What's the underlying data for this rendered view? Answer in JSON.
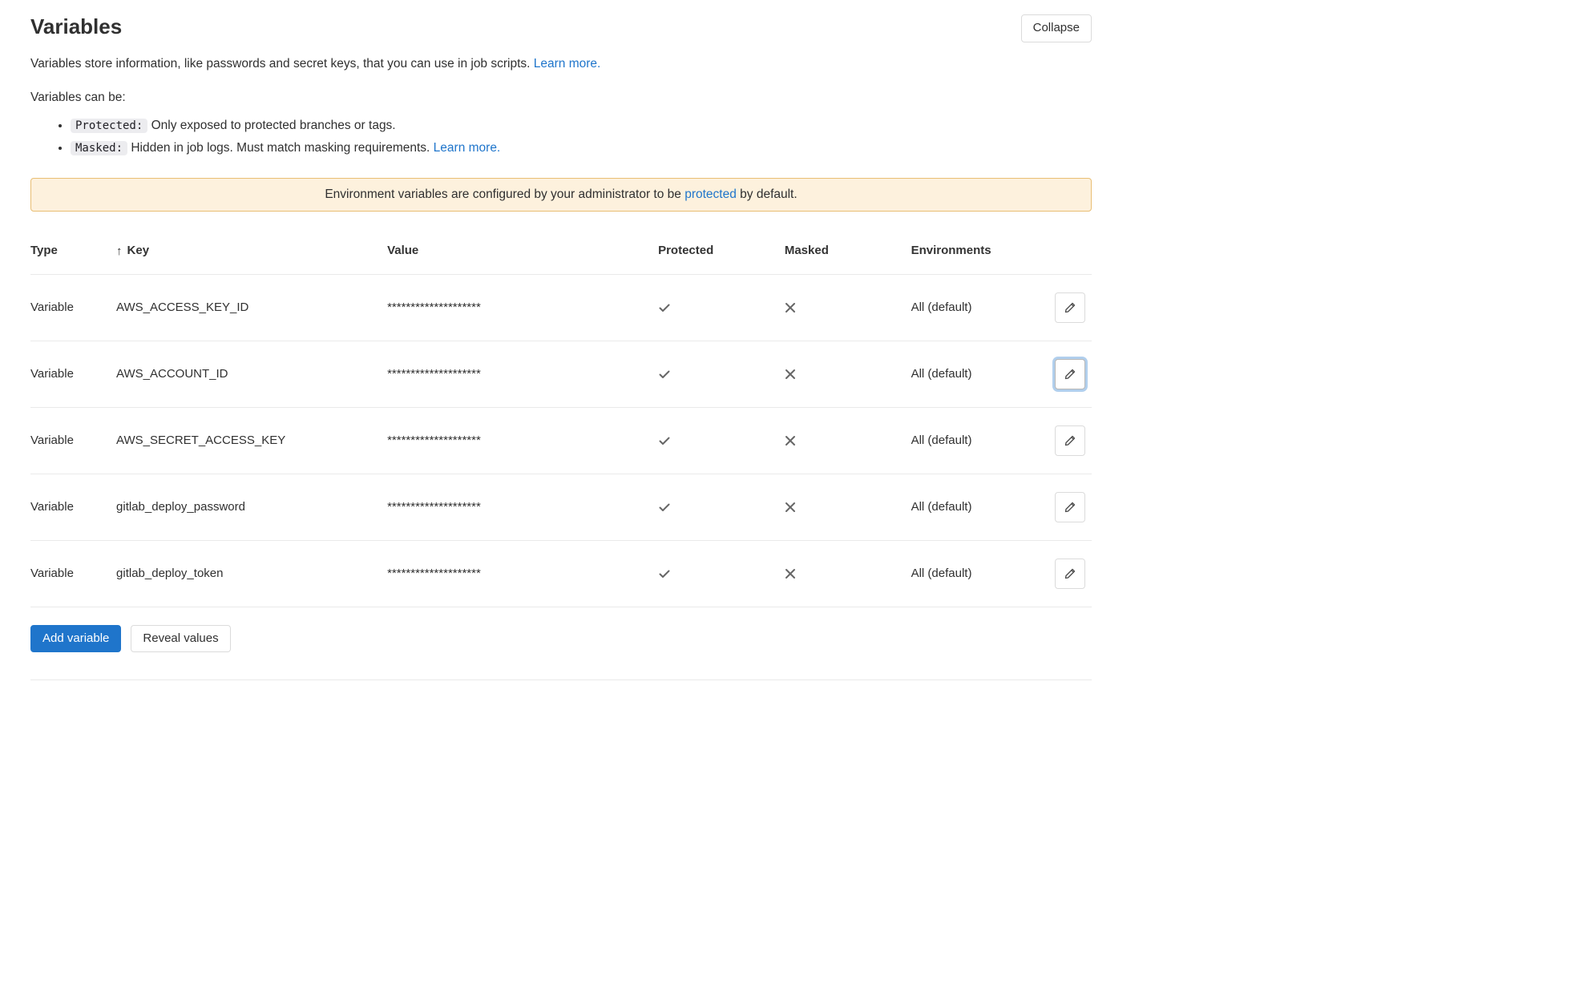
{
  "header": {
    "title": "Variables",
    "collapse_label": "Collapse",
    "description_prefix": "Variables store information, like passwords and secret keys, that you can use in job scripts. ",
    "learn_more": "Learn more.",
    "sub_description": "Variables can be:"
  },
  "bullets": {
    "protected_tag": "Protected:",
    "protected_text": " Only exposed to protected branches or tags.",
    "masked_tag": "Masked:",
    "masked_text": " Hidden in job logs. Must match masking requirements. ",
    "masked_learn_more": "Learn more."
  },
  "alert": {
    "prefix": "Environment variables are configured by your administrator to be ",
    "link": "protected",
    "suffix": " by default."
  },
  "table": {
    "headers": {
      "type": "Type",
      "key": "Key",
      "value": "Value",
      "protected": "Protected",
      "masked": "Masked",
      "environments": "Environments"
    },
    "rows": [
      {
        "type": "Variable",
        "key": "AWS_ACCESS_KEY_ID",
        "value": "********************",
        "protected": true,
        "masked": false,
        "environments": "All (default)",
        "focused": false
      },
      {
        "type": "Variable",
        "key": "AWS_ACCOUNT_ID",
        "value": "********************",
        "protected": true,
        "masked": false,
        "environments": "All (default)",
        "focused": true
      },
      {
        "type": "Variable",
        "key": "AWS_SECRET_ACCESS_KEY",
        "value": "********************",
        "protected": true,
        "masked": false,
        "environments": "All (default)",
        "focused": false
      },
      {
        "type": "Variable",
        "key": "gitlab_deploy_password",
        "value": "********************",
        "protected": true,
        "masked": false,
        "environments": "All (default)",
        "focused": false
      },
      {
        "type": "Variable",
        "key": "gitlab_deploy_token",
        "value": "********************",
        "protected": true,
        "masked": false,
        "environments": "All (default)",
        "focused": false
      }
    ]
  },
  "actions": {
    "add_variable": "Add variable",
    "reveal_values": "Reveal values"
  }
}
